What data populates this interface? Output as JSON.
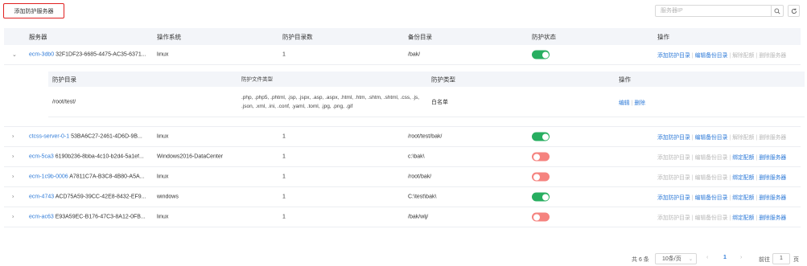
{
  "toolbar": {
    "add_button": "添加防护服务器",
    "search_placeholder": "服务器IP"
  },
  "table": {
    "headers": {
      "server": "服务器",
      "os": "操作系统",
      "count": "防护目录数",
      "backup": "备份目录",
      "status": "防护状态",
      "ops": "操作"
    },
    "rows": [
      {
        "expand": "⌄",
        "name": "ecm-3db0",
        "uuid": "32F1DF23-6685-4475-AC35-6371...",
        "os": "linux",
        "count": "1",
        "backup": "/bak/",
        "status": "on",
        "ops": [
          "添加防护目录",
          "编辑备份目录",
          "解除配额",
          "删除服务器"
        ],
        "ops_enabled": [
          true,
          true,
          false,
          false
        ]
      },
      {
        "expand": "›",
        "name": "ctcss-server-0-1",
        "uuid": "53BA6C27-2461-4D6D-9B...",
        "os": "linux",
        "count": "1",
        "backup": "/root/test/bak/",
        "status": "on",
        "ops": [
          "添加防护目录",
          "编辑备份目录",
          "解除配额",
          "删除服务器"
        ],
        "ops_enabled": [
          true,
          true,
          false,
          false
        ]
      },
      {
        "expand": "›",
        "name": "ecm-5ca3",
        "uuid": "6190b236-8bba-4c10-b2d4-5a1ef...",
        "os": "Windows2016-DataCenter",
        "count": "1",
        "backup": "c:\\bak\\",
        "status": "off",
        "ops": [
          "添加防护目录",
          "编辑备份目录",
          "绑定配额",
          "删除服务器"
        ],
        "ops_enabled": [
          false,
          false,
          true,
          true
        ]
      },
      {
        "expand": "›",
        "name": "ecm-1c9b-0006",
        "uuid": "A7811C7A-B3C8-4B80-A5A...",
        "os": "linux",
        "count": "1",
        "backup": "/root/bak/",
        "status": "off",
        "ops": [
          "添加防护目录",
          "编辑备份目录",
          "绑定配额",
          "删除服务器"
        ],
        "ops_enabled": [
          false,
          false,
          true,
          true
        ]
      },
      {
        "expand": "›",
        "name": "ecm-4743",
        "uuid": "ACD75A59-39CC-42E8-8432-EF9...",
        "os": "windows",
        "count": "1",
        "backup": "C:\\test\\bak\\",
        "status": "on",
        "ops": [
          "添加防护目录",
          "编辑备份目录",
          "绑定配额",
          "删除服务器"
        ],
        "ops_enabled": [
          true,
          true,
          true,
          true
        ]
      },
      {
        "expand": "›",
        "name": "ecm-ac63",
        "uuid": "E93A59EC-B176-47C3-8A12-0FB...",
        "os": "linux",
        "count": "1",
        "backup": "/bak/wlj/",
        "status": "off",
        "ops": [
          "添加防护目录",
          "编辑备份目录",
          "绑定配额",
          "删除服务器"
        ],
        "ops_enabled": [
          false,
          false,
          true,
          true
        ]
      }
    ]
  },
  "subtable": {
    "headers": {
      "dir": "防护目录",
      "filetypes": "防护文件类型",
      "kind": "防护类型",
      "ops": "操作"
    },
    "row": {
      "dir": "/root/test/",
      "filetypes": ".php, .php5, .phtml, .jsp, .jspx, .asp, .aspx, .html, .htm, .shtm, .shtml, .css, .js, .json, .xml, .ini, .conf, .yaml, .toml, .jpg, .png, .gif",
      "kind": "白名单",
      "op_edit": "编辑",
      "op_delete": "删除"
    }
  },
  "pager": {
    "total": "共 6 条",
    "page_size": "10条/页",
    "current_page": "1",
    "goto_label": "前往",
    "goto_value": "1",
    "page_unit": "页"
  },
  "colors": {
    "link": "#2f7bd8",
    "toggle_on": "#27ae60",
    "toggle_off": "#f5837f",
    "highlight_border": "#e02020"
  }
}
